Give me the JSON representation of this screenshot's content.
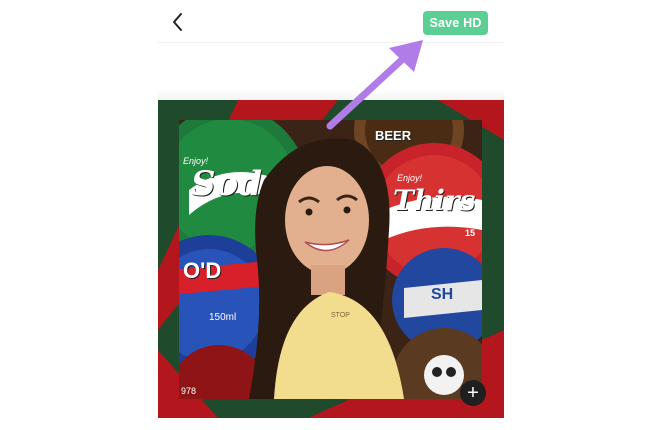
{
  "header": {
    "back_icon": "chevron-left-icon",
    "save_label": "Save HD"
  },
  "colors": {
    "accent": "#5ccf95",
    "frame_green": "#1f4a2c",
    "frame_red": "#b3161c",
    "annotation_arrow": "#b07ce8"
  },
  "caps": {
    "soda_tag": "Enjoy!",
    "soda_word": "Sod",
    "beer_word": "BEER",
    "thirst_tag": "Enjoy!",
    "thirst_word": "Thirs",
    "small_label": "15",
    "volume": "150ml",
    "blue_cap_word": "O'D",
    "blue_cap_word2": "SH",
    "bottom_number": "978",
    "shirt_print": "STOP"
  },
  "controls": {
    "add_icon": "plus-icon"
  }
}
